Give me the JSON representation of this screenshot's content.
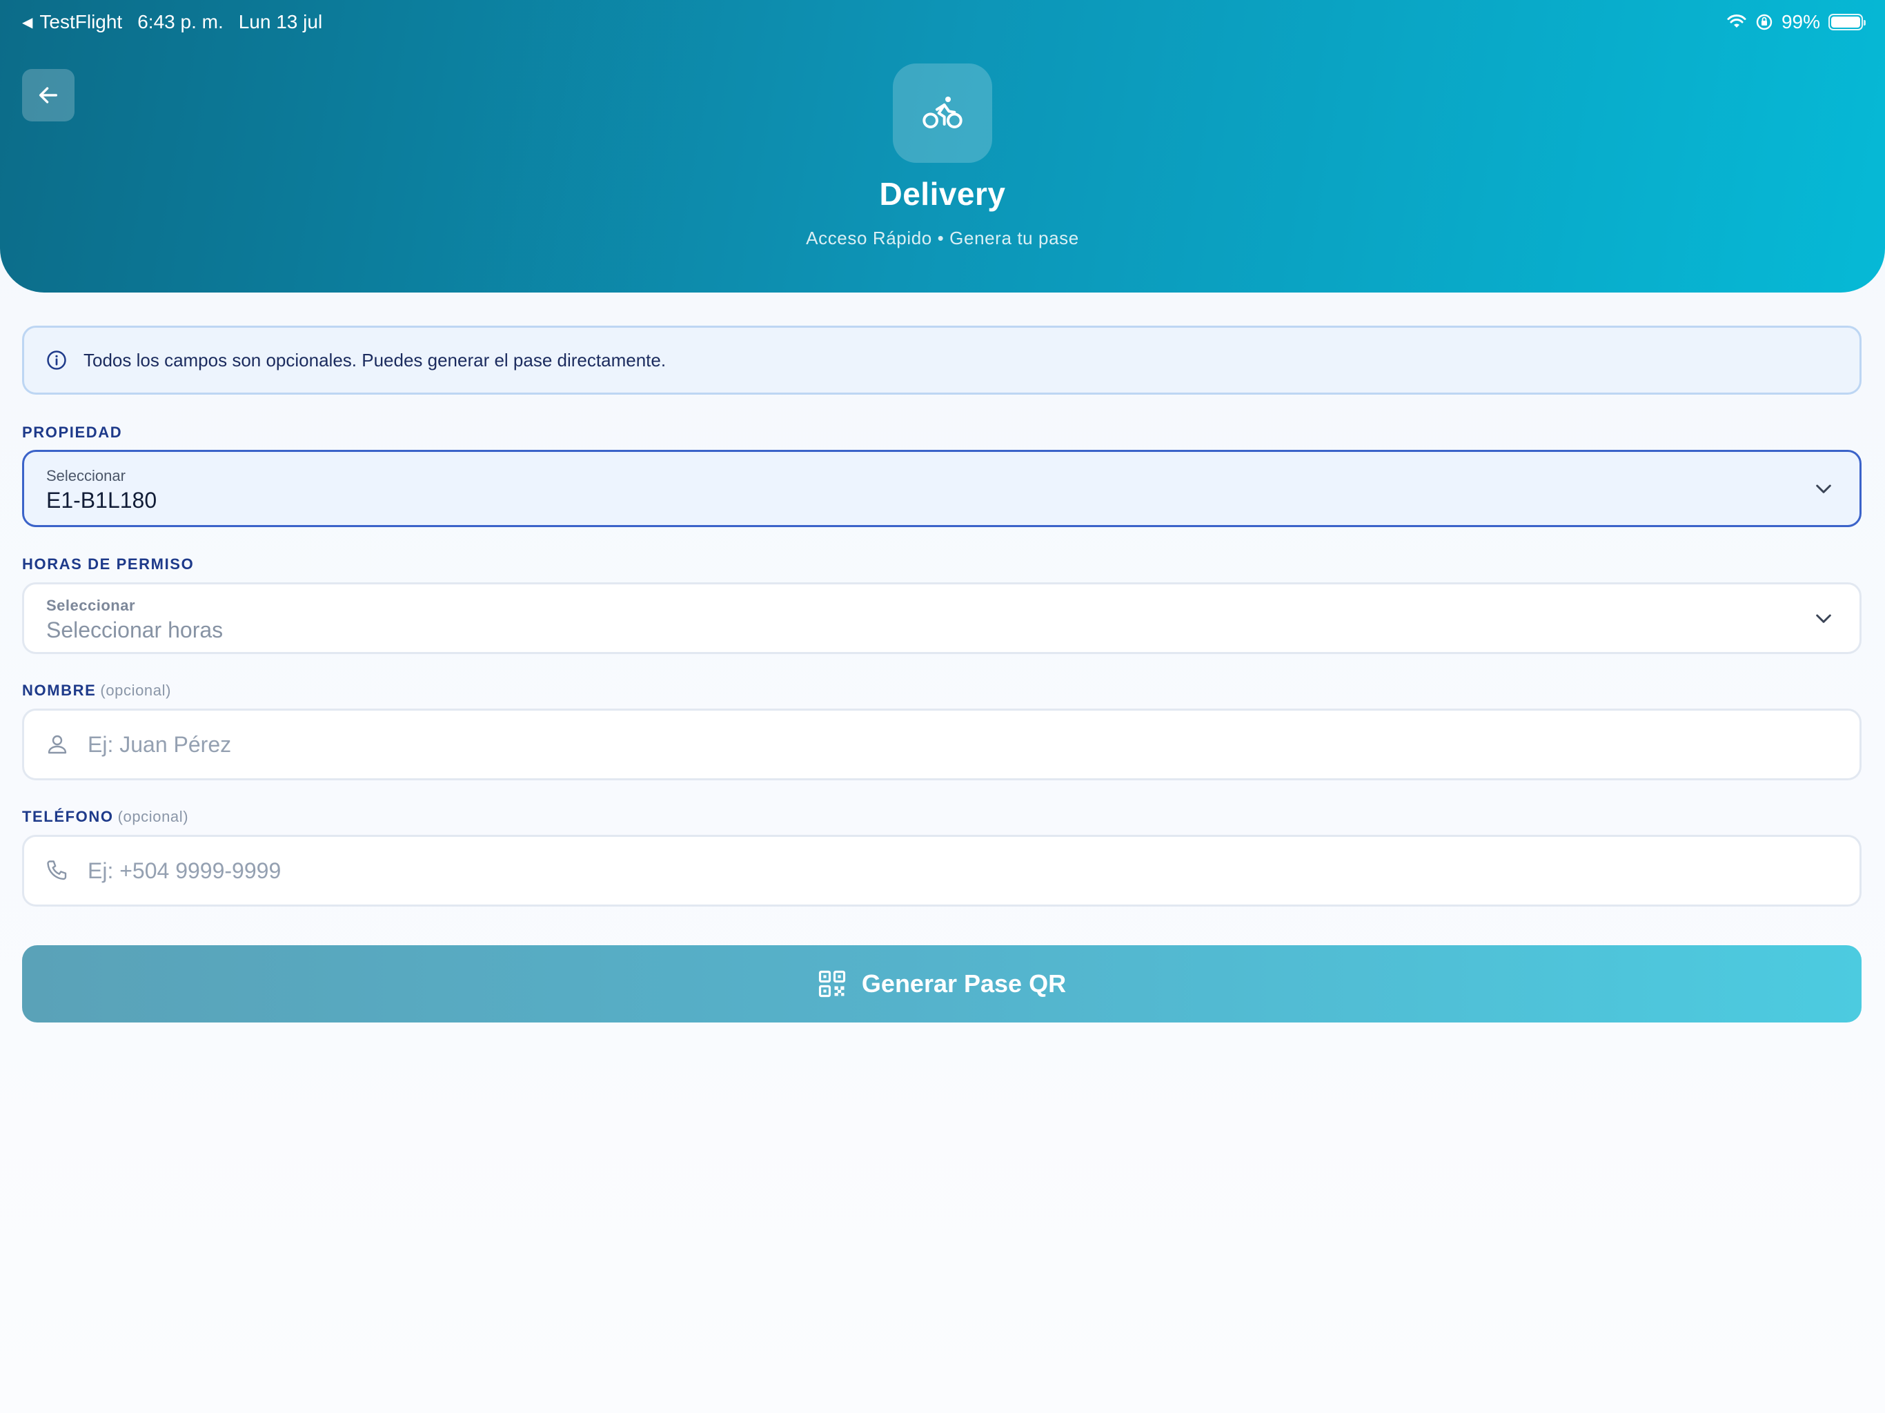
{
  "status_bar": {
    "back_app": "TestFlight",
    "time": "6:43 p. m.",
    "date": "Lun 13 jul",
    "battery": "99%"
  },
  "header": {
    "title": "Delivery",
    "subtitle": "Acceso Rápido • Genera tu pase",
    "icon": "bicycle-icon"
  },
  "info_banner": {
    "text": "Todos los campos son opcionales. Puedes generar el pase directamente."
  },
  "property": {
    "label": "PROPIEDAD",
    "caption": "Seleccionar",
    "value": "E1-B1L180"
  },
  "hours": {
    "label": "HORAS DE PERMISO",
    "caption": "Seleccionar",
    "placeholder": "Seleccionar horas"
  },
  "name": {
    "label": "NOMBRE",
    "optional": "(opcional)",
    "placeholder": "Ej: Juan Pérez"
  },
  "phone": {
    "label": "TELÉFONO",
    "optional": "(opcional)",
    "placeholder": "Ej: +504 9999-9999"
  },
  "generate_button": {
    "label": "Generar Pase QR"
  },
  "colors": {
    "header_start": "#0c6c89",
    "header_end": "#06b9d6",
    "label_blue": "#1e3a8a",
    "active_border": "#3b63c9",
    "button_start": "#5aa2b8",
    "button_end": "#4ccbe0"
  }
}
